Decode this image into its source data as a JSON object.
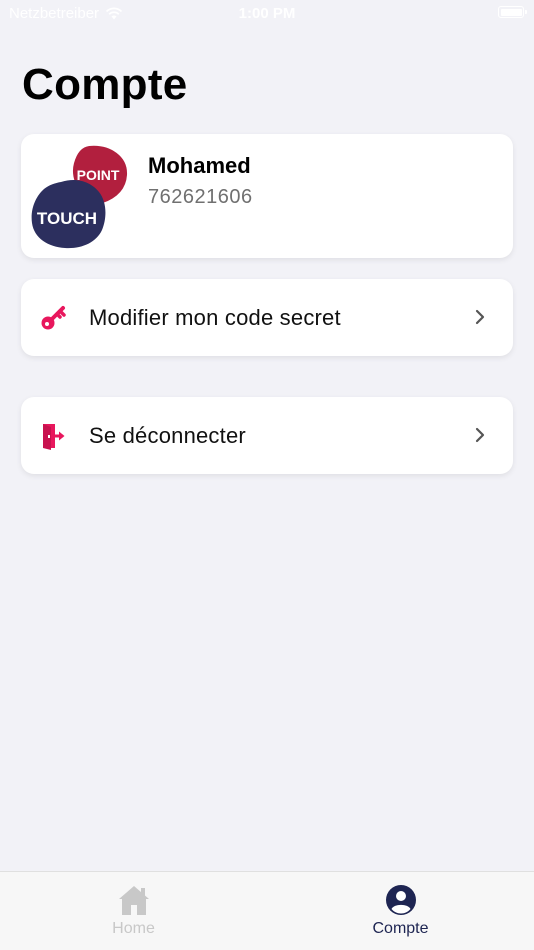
{
  "status_bar": {
    "carrier": "Netzbetreiber",
    "time": "1:00 PM"
  },
  "page": {
    "title": "Compte"
  },
  "profile": {
    "name": "Mohamed",
    "phone": "762621606",
    "logo_text_top": "POINT",
    "logo_text_bottom": "TOUCH"
  },
  "menu": {
    "items": [
      {
        "label": "Modifier mon code secret",
        "icon": "key-icon"
      },
      {
        "label": "Se déconnecter",
        "icon": "logout-icon"
      }
    ]
  },
  "tab_bar": {
    "tabs": [
      {
        "label": "Home",
        "icon": "home-icon",
        "active": false
      },
      {
        "label": "Compte",
        "icon": "user-circle-icon",
        "active": true
      }
    ]
  },
  "colors": {
    "background": "#f2f2f7",
    "accent_pink": "#e8175d",
    "logo_red": "#b21f3e",
    "logo_navy": "#2c2f5e",
    "tab_active": "#1e2552",
    "tab_inactive": "#c8c8c8"
  }
}
